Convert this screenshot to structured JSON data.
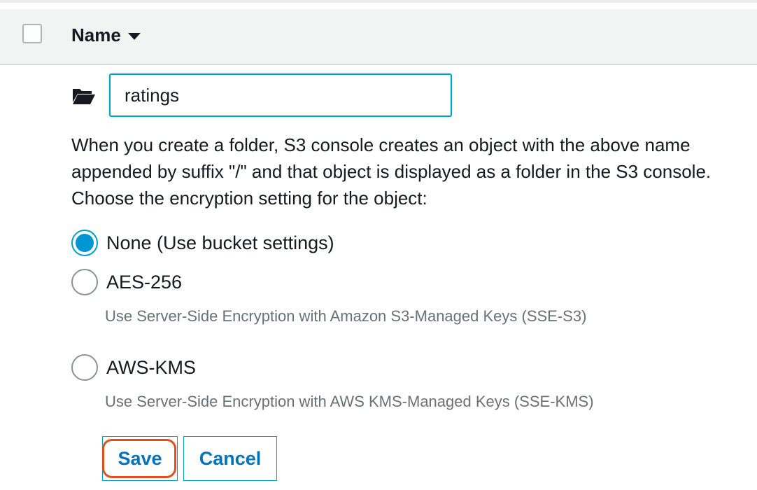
{
  "table": {
    "column_name": "Name"
  },
  "create_folder": {
    "input_value": "ratings",
    "description": "When you create a folder, S3 console creates an object with the above name appended by suffix \"/\" and that object is displayed as a folder in the S3 console. Choose the encryption setting for the object:",
    "options": [
      {
        "label": "None (Use bucket settings)",
        "hint": "",
        "selected": true
      },
      {
        "label": "AES-256",
        "hint": "Use Server-Side Encryption with Amazon S3-Managed Keys (SSE-S3)",
        "selected": false
      },
      {
        "label": "AWS-KMS",
        "hint": "Use Server-Side Encryption with AWS KMS-Managed Keys (SSE-KMS)",
        "selected": false
      }
    ],
    "save_label": "Save",
    "cancel_label": "Cancel"
  },
  "colors": {
    "accent": "#00a1c9",
    "link": "#0073bb",
    "highlight": "#e44d1c"
  },
  "icons": {
    "folder": "folder-open-icon",
    "sort": "caret-down-icon"
  }
}
